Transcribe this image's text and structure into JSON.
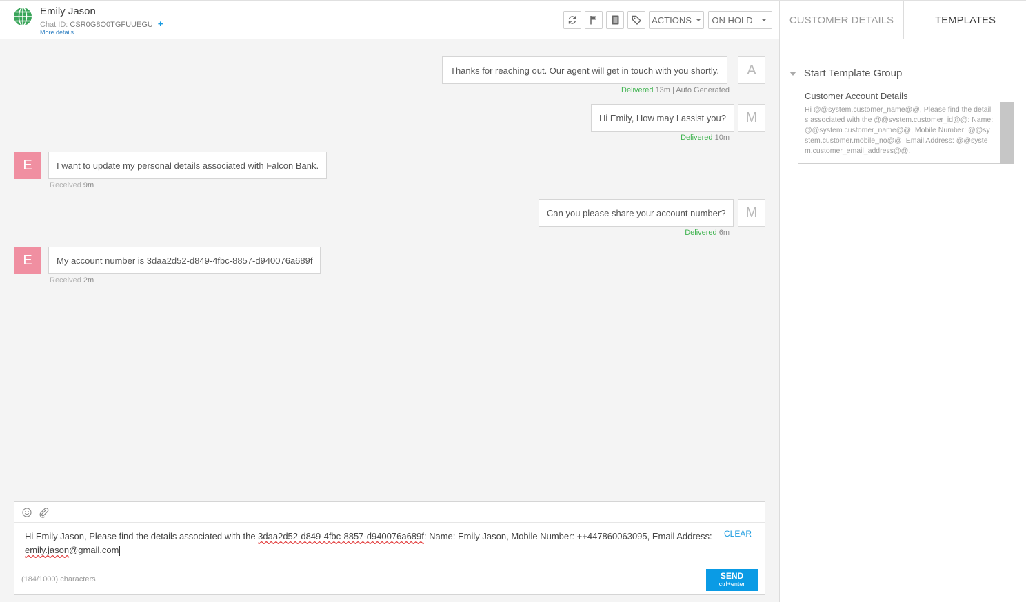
{
  "header": {
    "customer_name": "Emily Jason",
    "chat_id_label": "Chat ID:",
    "chat_id_value": "CSR0G8O0TGFUUEGU",
    "add_label": "+",
    "more_details": "More details",
    "actions_label": "ACTIONS",
    "status_label": "ON HOLD"
  },
  "tabs": {
    "customer_details": "CUSTOMER DETAILS",
    "templates": "TEMPLATES"
  },
  "templates": {
    "group_name": "Start Template Group",
    "card_title": "Customer Account Details",
    "card_body": "Hi @@system.customer_name@@, Please find the details associated with the @@system.customer_id@@: Name: @@system.customer_name@@, Mobile Number: @@system.customer.mobile_no@@, Email Address: @@system.customer_email_address@@."
  },
  "messages": [
    {
      "sender": "agent",
      "avatar": "A",
      "text": "Thanks for reaching out. Our agent will get in touch with you shortly.",
      "status": "Delivered",
      "time": "13m | Auto Generated"
    },
    {
      "sender": "agent",
      "avatar": "M",
      "text": "Hi Emily, How may I assist you?",
      "status": "Delivered",
      "time": "10m"
    },
    {
      "sender": "customer",
      "avatar": "E",
      "text": "I want to update my personal details associated with Falcon Bank.",
      "status": "Received",
      "time": "9m"
    },
    {
      "sender": "agent",
      "avatar": "M",
      "text": "Can you please share your account number?",
      "status": "Delivered",
      "time": "6m"
    },
    {
      "sender": "customer",
      "avatar": "E",
      "text": "My account number is 3daa2d52-d849-4fbc-8857-d940076a689f",
      "status": "Received",
      "time": "2m"
    }
  ],
  "composer": {
    "text_part1": "Hi Emily Jason, Please find the details associated with the ",
    "text_acct": "3daa2d52-d849-4fbc-8857-d940076a689f",
    "text_part2": ": Name: Emily Jason, Mobile Number: ++447860063095, Email Address:",
    "text_email_user": "emily.jason",
    "text_email_domain": "@gmail.com",
    "clear_label": "CLEAR",
    "char_count": "(184/1000) characters",
    "send_label": "SEND",
    "send_hint": "ctrl+enter"
  },
  "colors": {
    "accent": "#0a9be5",
    "delivered": "#3fb34f",
    "customer_avatar": "#f08fa1",
    "chat_bg": "#f4f4f4"
  }
}
